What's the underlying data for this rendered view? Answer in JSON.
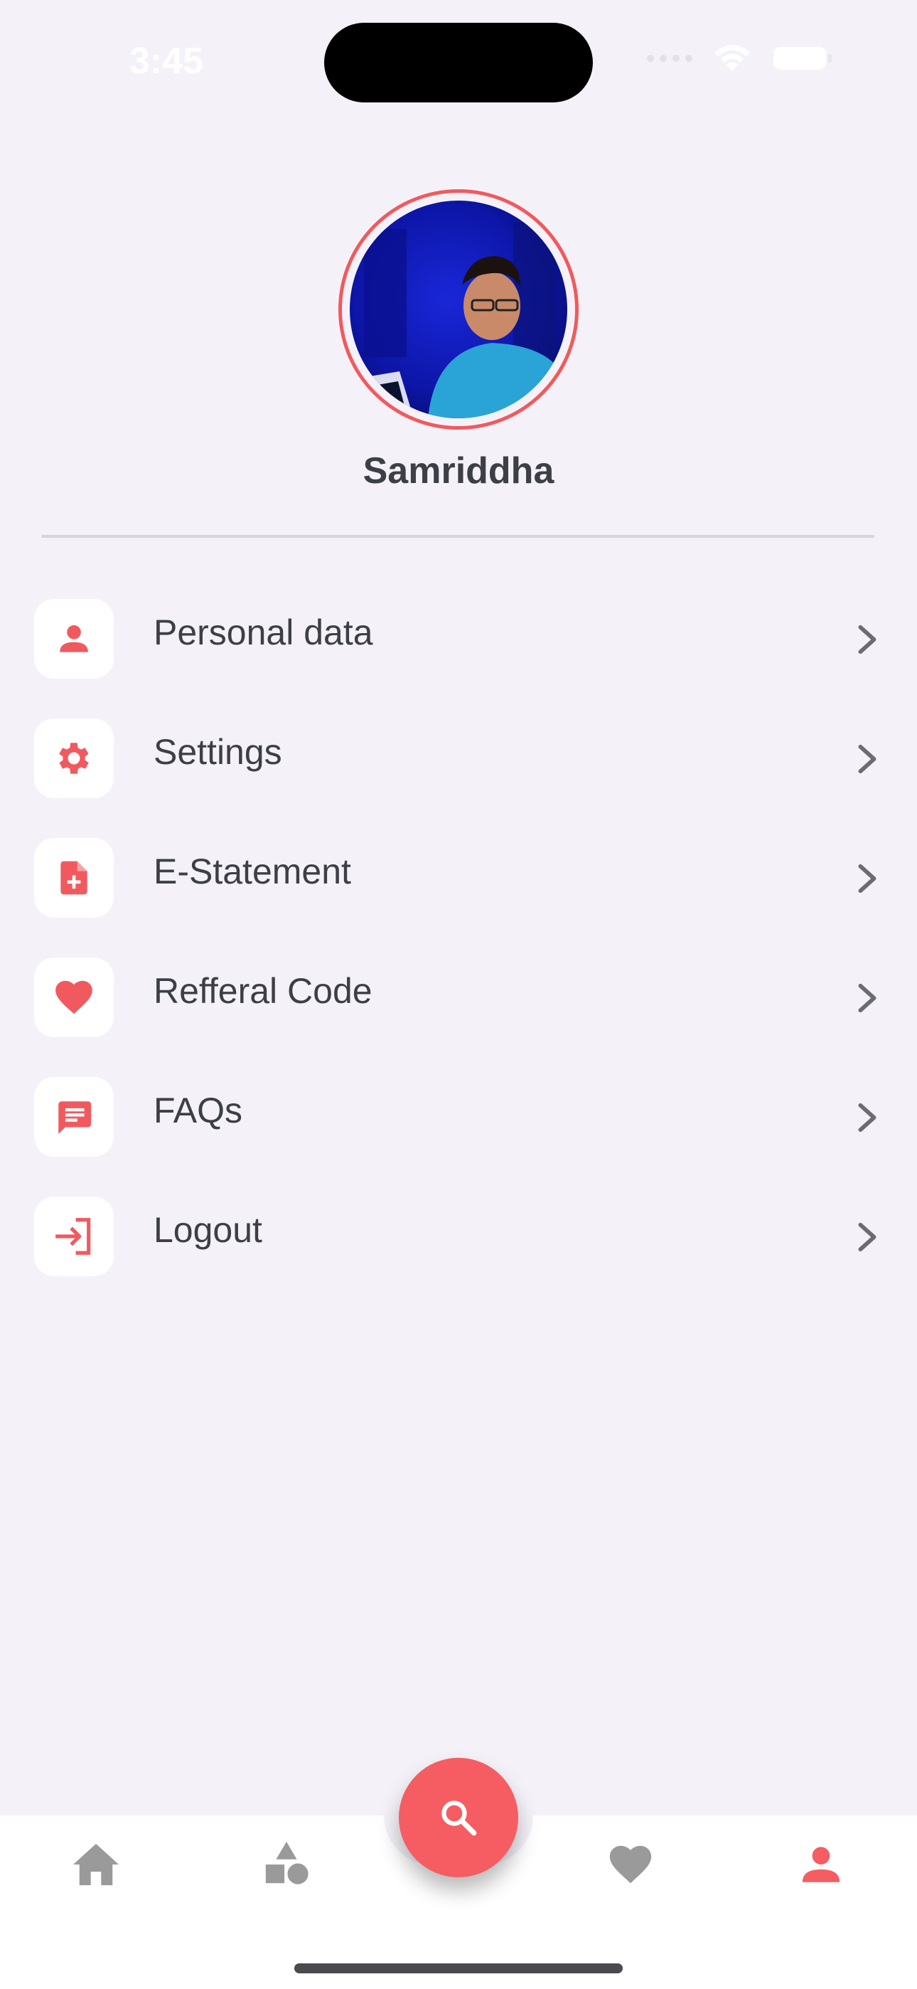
{
  "status_bar": {
    "time": "3:45"
  },
  "profile": {
    "name": "Samriddha",
    "accent_color": "#f05a5e"
  },
  "menu": {
    "items": [
      {
        "label": "Personal data",
        "icon": "person-icon"
      },
      {
        "label": "Settings",
        "icon": "gear-icon"
      },
      {
        "label": "E-Statement",
        "icon": "document-add-icon"
      },
      {
        "label": "Refferal Code",
        "icon": "heart-icon"
      },
      {
        "label": "FAQs",
        "icon": "chat-icon"
      },
      {
        "label": "Logout",
        "icon": "logout-icon"
      }
    ]
  },
  "bottom_nav": {
    "items": [
      {
        "icon": "home-icon",
        "active": false
      },
      {
        "icon": "shapes-icon",
        "active": false
      },
      {
        "icon": "search-icon",
        "active": false
      },
      {
        "icon": "heart-icon",
        "active": false
      },
      {
        "icon": "person-icon",
        "active": true
      }
    ],
    "active_color": "#f55d62",
    "inactive_color": "#9a9a9a"
  }
}
